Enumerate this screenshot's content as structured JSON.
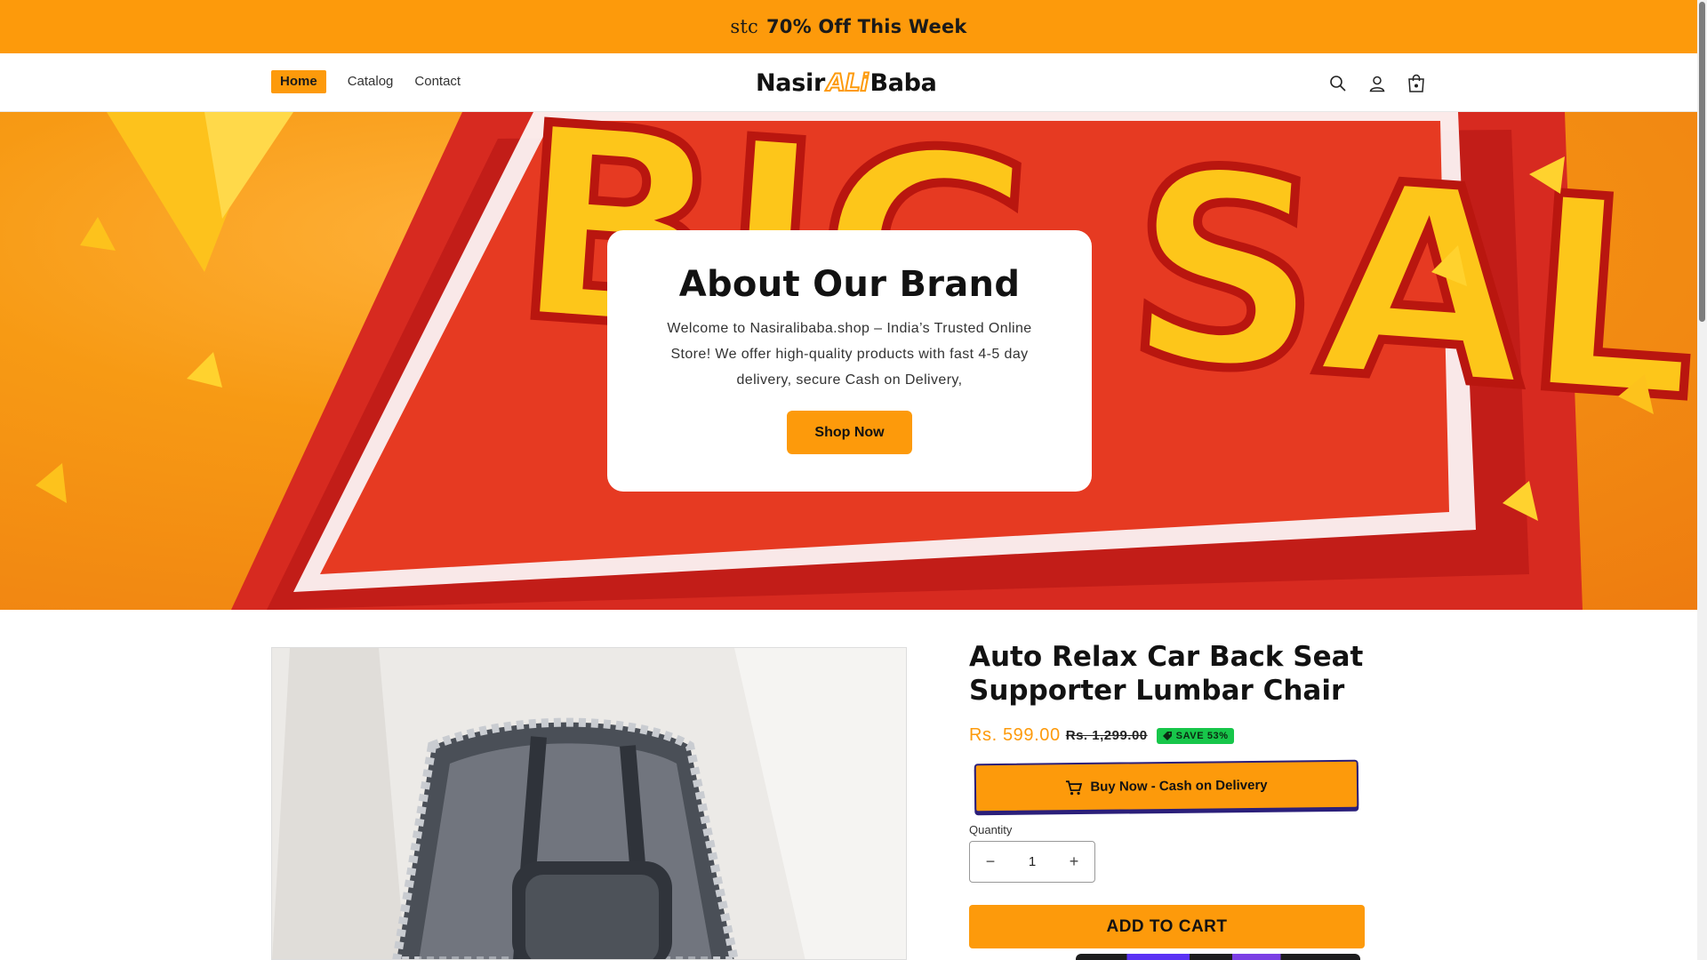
{
  "announcement": {
    "prefix": "stc",
    "text": "70% Off This Week"
  },
  "nav": {
    "items": [
      {
        "label": "Home"
      },
      {
        "label": "Catalog"
      },
      {
        "label": "Contact"
      }
    ]
  },
  "logo": {
    "part1": "Nasir",
    "part2": "ALi",
    "part3": "Baba"
  },
  "header_icons": [
    "search-icon",
    "account-icon",
    "cart-icon"
  ],
  "hero": {
    "background_text": "BIG SALE",
    "title": "About Our Brand",
    "body": "Welcome to Nasiralibaba.shop – India’s Trusted Online Store! We offer high-quality products with fast 4-5 day delivery, secure Cash on Delivery,",
    "button_label": "Shop Now"
  },
  "product": {
    "title": "Auto Relax Car Back Seat Supporter Lumbar Chair",
    "price_sale": "Rs. 599.00",
    "price_compare": "Rs. 1,299.00",
    "save_label": "SAVE 53%",
    "buy_now_label": "Buy Now - Cash on Delivery",
    "quantity_label": "Quantity",
    "quantity_value": "1",
    "minus": "−",
    "plus": "+",
    "add_to_cart_label": "ADD TO CART"
  },
  "colors": {
    "accent": "#fd9a0b",
    "save_badge": "#17c64a",
    "buy_border": "#2b1f7a"
  }
}
